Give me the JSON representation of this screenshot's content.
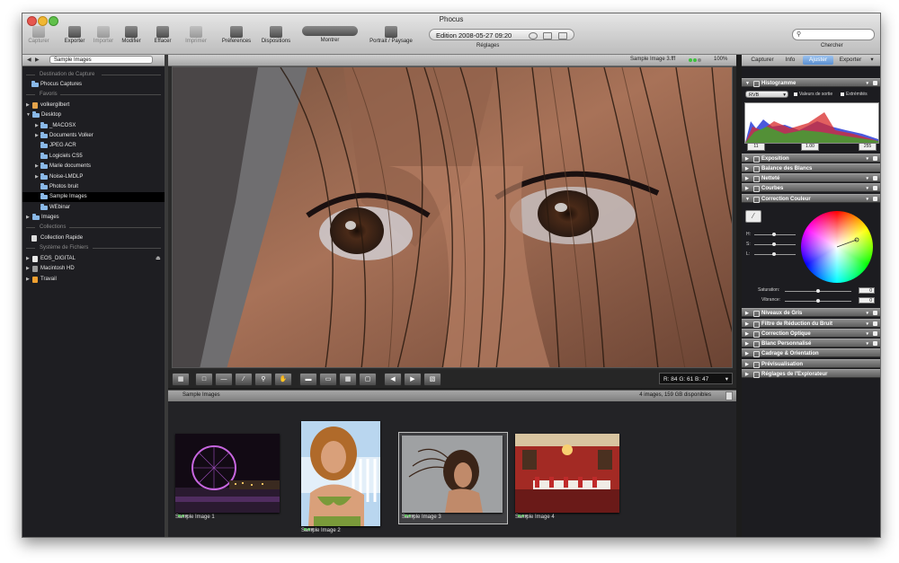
{
  "window": {
    "title": "Phocus"
  },
  "toolbar": {
    "capturer": "Capturer",
    "exporter": "Exporter",
    "importer": "Importer",
    "modifier": "Modifier",
    "effacer": "Effacer",
    "imprimer": "Imprimer",
    "preferences": "Préferences",
    "dispositions": "Dispositions",
    "montrer": "Montrer",
    "portrait": "Portrait / Paysage",
    "edition": "Edition 2008-05-27 09:20",
    "reglages": "Réglages",
    "chercher": "Chercher",
    "search_placeholder": ""
  },
  "sidebar": {
    "selector": "Sample Images",
    "destination_header": "Destination de Capture",
    "phocus_captures": "Phocus Captures",
    "favoris_header": "Favoris",
    "volkergilbert": "volkergilbert",
    "desktop": "Desktop",
    "macosx": "_MACOSX",
    "documents_volker": "Documents Volker",
    "jpeg_acr": "JPEG ACR",
    "logiciels_cs5": "Logiciels CS5",
    "marie_documents": "Marie documents",
    "noise_lmdlp": "Noise-LMDLP",
    "photos_bruit": "Photos bruit",
    "sample_images": "Sample Images",
    "webinar": "WEbinar",
    "images": "Images",
    "collections_header": "Collections",
    "collection_rapide": "Collection Rapide",
    "systeme_header": "Système de Fichiers",
    "eos_digital": "EOS_DIGITAL",
    "macintosh_hd": "Macintosh HD",
    "travail": "Travail"
  },
  "viewer": {
    "filename": "Sample Image 3.fff",
    "zoom": "100%",
    "rgb_readout": "R:  84  G:  61  B:  47"
  },
  "browser": {
    "folder": "Sample Images",
    "count": "4 images, 159 GB disponibles",
    "thumbs": [
      "Sample Image 1",
      "Sample Image 2",
      "Sample Image 3",
      "Sample Image 4"
    ]
  },
  "right_panel": {
    "tabs": [
      "Capturer",
      "Info",
      "Ajuster",
      "Exporter"
    ],
    "active_tab": "Ajuster",
    "histogramme": "Histogramme",
    "histo_channel": "RVB",
    "valeurs_sortie": "Valeurs de sortie",
    "extremites": "Extrémités",
    "histo_low": "11",
    "histo_mid": "1.00",
    "histo_high": "255",
    "exposition": "Exposition",
    "balance_blancs": "Balance des Blancs",
    "nettete": "Netteté",
    "courbes": "Courbes",
    "correction_couleur": "Correction Couleur",
    "h_label": "H:",
    "s_label": "S:",
    "l_label": "L:",
    "saturation": "Saturation:",
    "saturation_val": "0",
    "vibrance": "Vibrance:",
    "vibrance_val": "0",
    "niveaux_gris": "Niveaux de Gris",
    "filtre_bruit": "Filtre de Réduction du Bruit",
    "correction_optique": "Correction Optique",
    "blanc_perso": "Blanc Personnalisé",
    "cadrage": "Cadrage & Orientation",
    "previsualisation": "Prévisualisation",
    "reglages_explorateur": "Réglages de l'Explorateur"
  },
  "colors": {
    "accent": "#5a8fd0",
    "sidebar_bg": "#1e1e22",
    "selected_row": "#000000"
  }
}
